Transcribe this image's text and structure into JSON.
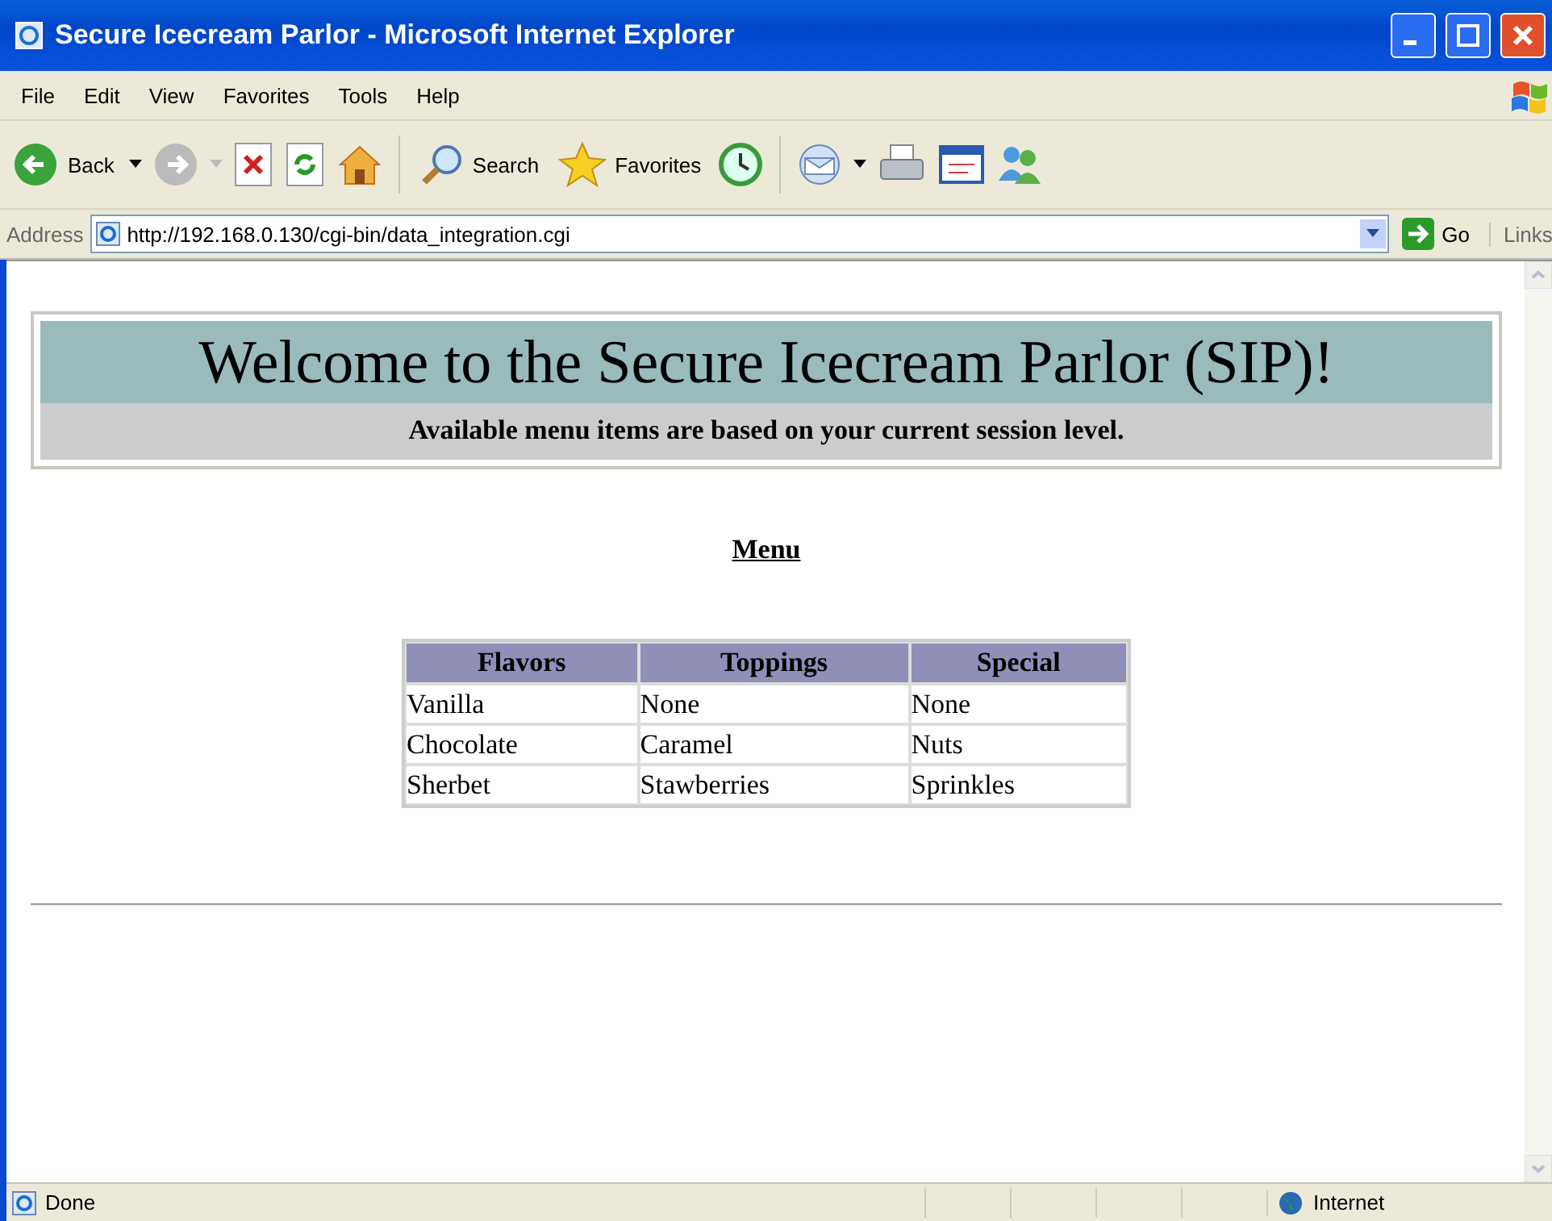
{
  "window": {
    "title": "Secure Icecream Parlor - Microsoft Internet Explorer"
  },
  "menu_bar": [
    "File",
    "Edit",
    "View",
    "Favorites",
    "Tools",
    "Help"
  ],
  "toolbar": {
    "back": "Back",
    "search": "Search",
    "favorites": "Favorites"
  },
  "address_bar": {
    "label": "Address",
    "value": "http://192.168.0.130/cgi-bin/data_integration.cgi",
    "go": "Go",
    "links": "Links"
  },
  "page": {
    "heading": "Welcome to the Secure Icecream Parlor (SIP)!",
    "subheading": "Available menu items are based on your current session level.",
    "menu_title": "Menu",
    "table": {
      "columns": [
        "Flavors",
        "Toppings",
        "Special"
      ],
      "rows": [
        [
          "Vanilla",
          "None",
          "None"
        ],
        [
          "Chocolate",
          "Caramel",
          "Nuts"
        ],
        [
          "Sherbet",
          "Stawberries",
          "Sprinkles"
        ]
      ]
    }
  },
  "status_bar": {
    "text": "Done",
    "zone": "Internet"
  }
}
